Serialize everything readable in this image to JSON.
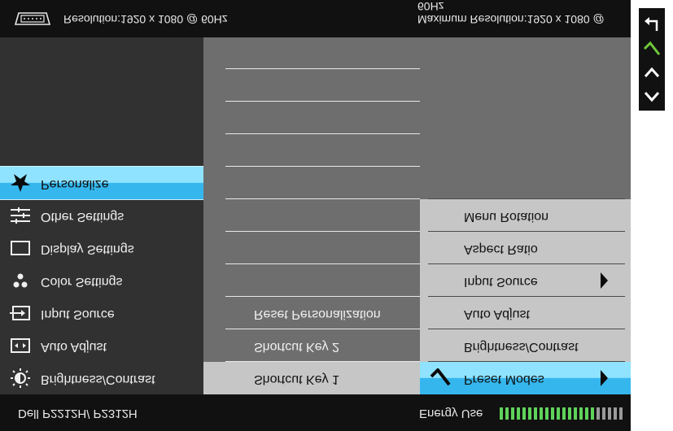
{
  "top_bar": {
    "resolution_text": "Resolution:1920 x 1080 @ 60Hz",
    "max_resolution_text": "Maximum Resolution:1920 x 1080 @ 60Hz",
    "connector_icon": "vga-connector-icon"
  },
  "bottom_bar": {
    "model": "Dell P2212H/ P2312H",
    "energy_label": "Energy Use",
    "energy_level": 0.77
  },
  "main_menu": {
    "items": [
      {
        "label": "Brightness/Contrast",
        "icon": "brightness-icon"
      },
      {
        "label": "Auto Adjust",
        "icon": "auto-adjust-icon"
      },
      {
        "label": "Input Source",
        "icon": "input-source-icon"
      },
      {
        "label": "Color Settings",
        "icon": "color-settings-icon"
      },
      {
        "label": "Display Settings",
        "icon": "display-settings-icon"
      },
      {
        "label": "Other Settings",
        "icon": "other-settings-icon"
      },
      {
        "label": "Personalize",
        "icon": "star-icon",
        "selected": true
      }
    ]
  },
  "personalize_menu": {
    "items": [
      {
        "label": "Shortcut Key 1",
        "highlighted": true
      },
      {
        "label": "Shortcut Key 2"
      },
      {
        "label": "Reset Personalization"
      }
    ]
  },
  "shortcut_options": {
    "items": [
      {
        "label": "Preset Modes",
        "selected": true,
        "has_submenu": true
      },
      {
        "label": "Brightness/Contrast"
      },
      {
        "label": "Auto Adjust"
      },
      {
        "label": "Input Source",
        "has_submenu": true
      },
      {
        "label": "Aspect Ratio"
      },
      {
        "label": "Menu Rotation"
      }
    ]
  },
  "side_buttons": [
    {
      "icon": "down-arrow-icon"
    },
    {
      "icon": "up-arrow-icon"
    },
    {
      "icon": "check-icon",
      "color": "#6ec93a"
    },
    {
      "icon": "back-icon"
    }
  ],
  "colors": {
    "selection_blue": "#35b7ee",
    "selection_light": "#8fe3ff",
    "energy_green": "#5fd35a",
    "energy_empty": "#9a9a9a"
  }
}
